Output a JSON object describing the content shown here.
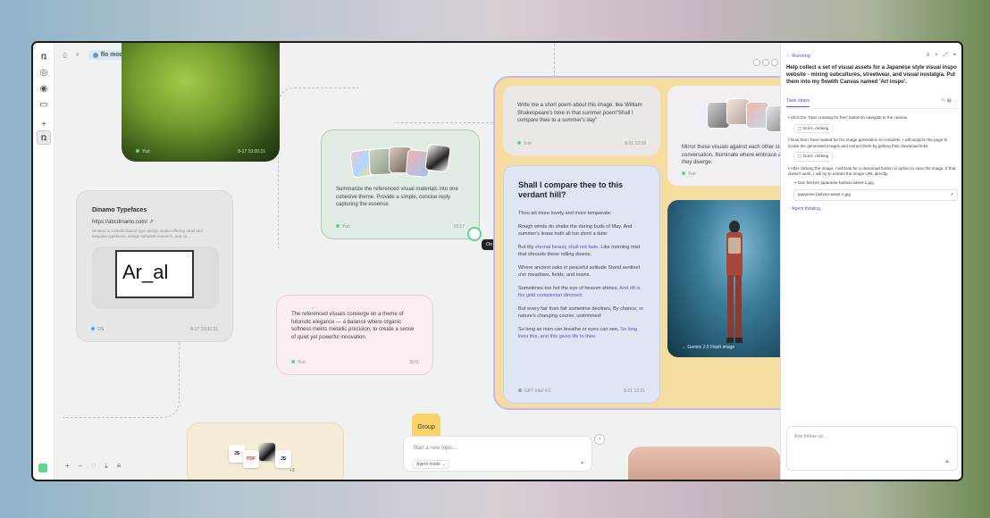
{
  "topbar": {
    "mode_label": "flo mode"
  },
  "rail": {
    "logo": "ռ",
    "active": "ռ"
  },
  "grass_card": {
    "author": "Yuri",
    "time": "8-17 10:00:21"
  },
  "dinamo_card": {
    "title": "Dinamo Typefaces",
    "url": "https://abcdinamo.com/",
    "description": "Dinamo is a Berlin-based type design studio offering retail and bespoke typefaces, design software research, and co...",
    "screen_text": "Ar_al",
    "author": "OS",
    "time": "8-17 10:00:21"
  },
  "summary_card": {
    "text": "Summarize the referenced visual materials into one cohesive theme. Provide a simple, concise reply capturing the essence.",
    "author": "Yuri",
    "time": "10:17"
  },
  "pink_card": {
    "text": "The referenced visuals converge on a theme of futuristic elegance — a balance where organic softness meets metallic precision, to create a sense of quiet yet powerful innovation.",
    "author": "Yuri",
    "time": "30:0"
  },
  "file_stack": {
    "items": [
      "JS",
      "PDF",
      "JS"
    ],
    "more": "+3"
  },
  "poem_card": {
    "text": "Write me a short poem about this image, like William Shakespeare's tone in that summer poem\"Shall I compare thee to a summer's day\"",
    "author": "Yuri",
    "time": "8-21 12:09"
  },
  "verdant_card": {
    "title": "Shall I compare thee to this verdant hill?",
    "line1": "Thou art more lovely and more temperate:",
    "stanza2": "Rough winds do shake the daring buds of May, And summer's lease hath all too short a date:",
    "stanza3_a": "But thy ",
    "stanza3_hl": "eternal beauty shall not fade",
    "stanza3_b": ", Like morning mist that shrouds these rolling downs,",
    "stanza4": "Where ancient oaks in peaceful solitude Stand sentinel o'er meadows, fields, and towns.",
    "stanza5_a": "Sometimes too hot the eye of heaven shines, ",
    "stanza5_hl": "And oft is his gold complexion dimmed;",
    "stanza6": "But every fair from fair sometime declines, By chance, or nature's changing course, untrimmed:",
    "stanza7_a": "So long as men can breathe or eyes can see, ",
    "stanza7_hl": "So long lives this, and this gives life to thee.",
    "model": "GPT Intel 4.0",
    "time": "8-21 12:31"
  },
  "mirror_card": {
    "text": "Mirror these visuals against each other stars in conversation. Illuminate where embrace and where they diverge.",
    "author": "Yuri"
  },
  "photo_card": {
    "caption": "← Gemini 2.5 Flash image"
  },
  "tooltip": "On it, right now!",
  "group_tag": "Group",
  "topic_input": {
    "placeholder": "Start a new topic...",
    "mode": "Agent mode ⌄"
  },
  "panel": {
    "status": "Running",
    "prompt": "Help collect a set of visual assets for a Japanese style visual inspo website - mixing subcultures, streetwear, and visual nostalgia. Put them into my flowith Canvas named 'Art inspo'.",
    "tab": "Task steps",
    "steps": [
      {
        "text": "Click the 'Start creating for free' button to navigate to the canvas.",
        "button": "Got it, clicking"
      },
      {
        "text": "Now that I have waited for the image generation to complete, I will analyze the page to locate the generated images and extract them by getting their download links.",
        "button": "Got it, clicking"
      },
      {
        "text": "After clicking the image, I will look for a download button or option to save the image. If that doesn't work, I will try to extract the image URL directly.",
        "fetch": "↪ Nov fetches japanese-fashion-asset-1.jpg",
        "file": "japanese-fashion-asset-1.jpg"
      }
    ],
    "thinking": "Agent thinking...",
    "follow_placeholder": "Ask follow up..."
  },
  "colors": {
    "accent": "#5a4fd6",
    "running_green": "#5fd48f"
  }
}
